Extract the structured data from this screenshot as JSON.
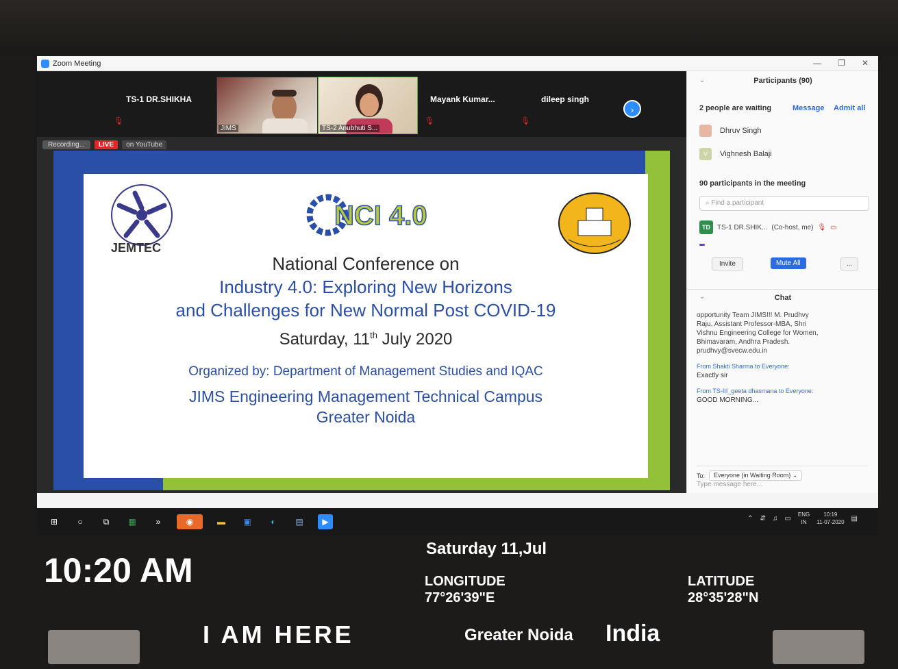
{
  "window": {
    "title": "Zoom Meeting"
  },
  "video_strip": {
    "tiles": [
      {
        "name": "TS-1 DR.SHIKHA"
      },
      {
        "name": "JIMS"
      },
      {
        "name": "TS-2 Anubhuti S..."
      },
      {
        "name": "Mayank Kumar..."
      },
      {
        "name": "dileep singh"
      }
    ]
  },
  "recording": {
    "status": "Recording...",
    "live": "LIVE",
    "platform": "on YouTube"
  },
  "slide": {
    "logo_left_text": "JEMTEC",
    "logo_center_text": "NCI 4.0",
    "line1": "National Conference on",
    "line2": "Industry 4.0: Exploring New Horizons",
    "line3": "and Challenges for New Normal Post COVID-19",
    "date_prefix": "Saturday, 11",
    "date_sup": "th",
    "date_suffix": " July 2020",
    "organized": "Organized by: Department of Management Studies and IQAC",
    "campus_line1": "JIMS Engineering Management Technical Campus",
    "campus_line2": "Greater Noida"
  },
  "participants": {
    "header": "Participants (90)",
    "waiting_text": "2 people are waiting",
    "message_btn": "Message",
    "admit_all_btn": "Admit all",
    "waiting": [
      {
        "name": "Dhruv Singh",
        "initial": ""
      },
      {
        "name": "Vighnesh Balaji",
        "initial": "V"
      }
    ],
    "in_meeting_text": "90 participants in the meeting",
    "search_placeholder": "Find a participant",
    "row": {
      "initials": "TD",
      "name": "TS-1 DR.SHIK...",
      "role": "(Co-host, me)"
    },
    "invite_btn": "Invite",
    "mute_all_btn": "Mute All",
    "more_btn": "..."
  },
  "chat": {
    "header": "Chat",
    "lines": [
      "opportunity Team JIMS!!! M. Prudhvy",
      "Raju, Assistant Professor-MBA, Shri",
      "Vishnu Engineering College for Women,",
      "Bhimavaram, Andhra Pradesh.",
      "prudhvy@svecw.edu.in"
    ],
    "messages": [
      {
        "from": "From Shakti Sharma to Everyone:",
        "body": "Exactly sir"
      },
      {
        "from": "From TS-III_geeta dhasmana to Everyone:",
        "body": "GOOD MORNING..."
      }
    ],
    "to_label": "To:",
    "to_value": "Everyone (in Waiting Room)",
    "input_placeholder": "Type message here..."
  },
  "taskbar": {
    "lang": "ENG",
    "region": "IN",
    "clock_time": "10:19",
    "clock_date": "11-07-2020"
  },
  "stamp": {
    "time": "10:20 AM",
    "date": "Saturday 11,Jul",
    "longitude_label": "LONGITUDE",
    "longitude": "77°26'39\"E",
    "latitude_label": "LATITUDE",
    "latitude": "28°35'28\"N",
    "tagline": "I AM HERE",
    "city": "Greater Noida",
    "country": "India"
  },
  "colors": {
    "zoom_blue": "#2d8cff",
    "slide_blue": "#2a4fa8",
    "slide_green": "#93c23a",
    "live_red": "#e02828"
  }
}
